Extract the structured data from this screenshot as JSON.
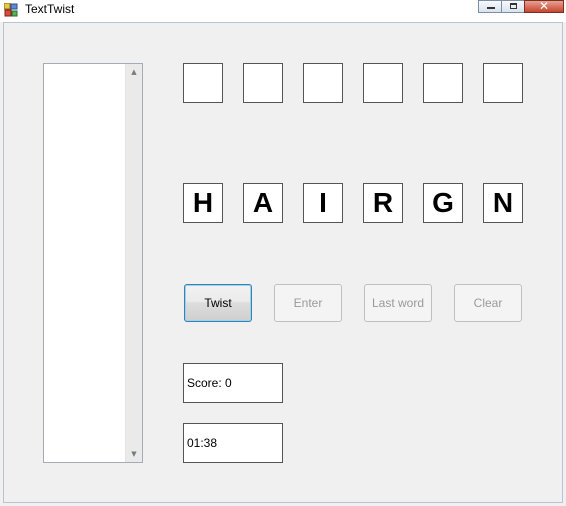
{
  "window": {
    "title": "TextTwist",
    "icon": "app-icon",
    "controls": [
      "minimize",
      "maximize",
      "close"
    ]
  },
  "answer_slots": [
    "",
    "",
    "",
    "",
    "",
    ""
  ],
  "letters": [
    "H",
    "A",
    "I",
    "R",
    "G",
    "N"
  ],
  "buttons": {
    "twist": "Twist",
    "enter": "Enter",
    "last_word": "Last word",
    "clear": "Clear"
  },
  "score": {
    "text": "Score: 0"
  },
  "timer": {
    "text": "01:38"
  },
  "words_list": {
    "items": []
  }
}
